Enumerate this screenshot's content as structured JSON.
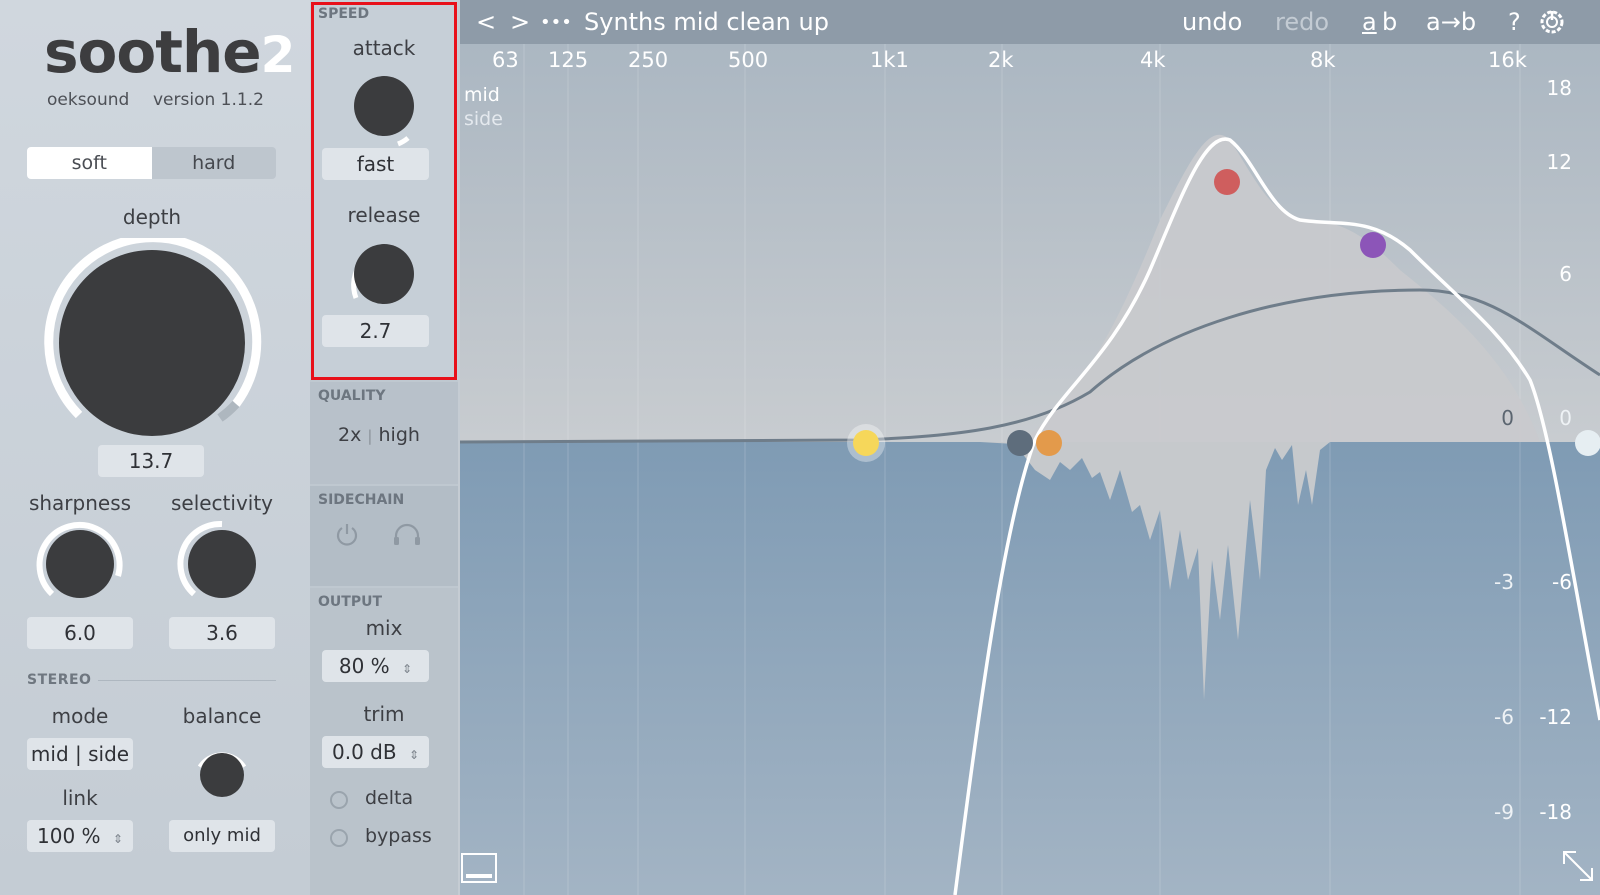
{
  "brand": {
    "name": "soothe",
    "version_digit": "2",
    "company": "oeksound",
    "version": "version 1.1.2"
  },
  "mode_toggle": {
    "soft": "soft",
    "hard": "hard",
    "selected": "soft"
  },
  "depth": {
    "label": "depth",
    "value": "13.7"
  },
  "sharpness": {
    "label": "sharpness",
    "value": "6.0"
  },
  "selectivity": {
    "label": "selectivity",
    "value": "3.6"
  },
  "stereo": {
    "title": "STEREO",
    "mode_label": "mode",
    "mode_value": "mid | side",
    "balance_label": "balance",
    "balance_value": "only mid",
    "link_label": "link",
    "link_value": "100 %"
  },
  "speed": {
    "title": "SPEED",
    "attack_label": "attack",
    "attack_value": "fast",
    "release_label": "release",
    "release_value": "2.7"
  },
  "quality": {
    "title": "QUALITY",
    "value_a": "2x",
    "separator": "|",
    "value_b": "high"
  },
  "sidechain": {
    "title": "SIDECHAIN"
  },
  "output": {
    "title": "OUTPUT",
    "mix_label": "mix",
    "mix_value": "80 %",
    "trim_label": "trim",
    "trim_value": "0.0 dB",
    "delta_label": "delta",
    "bypass_label": "bypass"
  },
  "topbar": {
    "back": "<",
    "forward": ">",
    "more": "•••",
    "preset": "Synths mid clean up",
    "undo": "undo",
    "redo": "redo",
    "ab_a": "a",
    "ab_b": "b",
    "a_to_b": "a→b",
    "help": "?"
  },
  "display": {
    "mid_label": "mid",
    "side_label": "side",
    "freq_labels": [
      "63",
      "125",
      "250",
      "500",
      "1k1",
      "2k",
      "4k",
      "8k",
      "16k"
    ],
    "db_right": [
      "18",
      "12",
      "6",
      "0",
      "-6",
      "-12",
      "-18"
    ],
    "db_left": [
      "0",
      "-3",
      "-6",
      "-9"
    ]
  },
  "colors": {
    "node_yellow": "#f6d75a",
    "node_slate": "#5e6d7c",
    "node_orange": "#e39a4b",
    "node_red": "#cf5e5e",
    "node_purple": "#8c55b8",
    "node_white": "#e6eef2",
    "accent_outline": "#e8101a"
  },
  "icons": [
    "back-icon",
    "forward-icon",
    "more-icon",
    "help-icon",
    "power-gear-icon",
    "power-icon",
    "headphones-icon",
    "resize-icon",
    "screen-icon"
  ]
}
